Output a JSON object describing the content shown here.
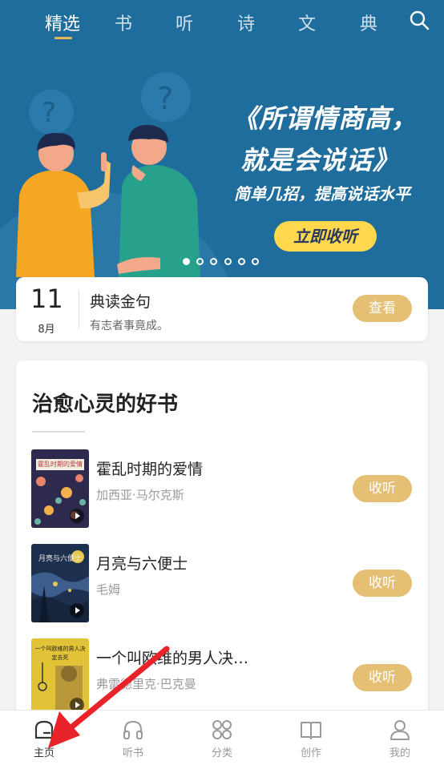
{
  "tabs": [
    {
      "label": "精选",
      "active": true
    },
    {
      "label": "书"
    },
    {
      "label": "听"
    },
    {
      "label": "诗"
    },
    {
      "label": "文"
    },
    {
      "label": "典"
    }
  ],
  "banner": {
    "title_line1": "《所谓情商高，",
    "title_line2": "就是会说话》",
    "subtitle": "简单几招，提高说话水平",
    "button": "立即收听",
    "dot_count": 6,
    "active_dot": 0
  },
  "daily": {
    "day": "11",
    "month": "8月",
    "title": "典读金句",
    "quote": "有志者事竟成。",
    "button": "查看"
  },
  "section": {
    "title": "治愈心灵的好书",
    "books": [
      {
        "title": "霍乱时期的爱情",
        "author": "加西亚·马尔克斯",
        "cover_text": "霍乱时期的爱情",
        "button": "收听"
      },
      {
        "title": "月亮与六便士",
        "author": "毛姆",
        "cover_text": "月亮与六便士",
        "button": "收听"
      },
      {
        "title": "一个叫欧维的男人决…",
        "author": "弗雷德里克·巴克曼",
        "cover_text": "一个叫欧维的男人决定去死",
        "button": "收听"
      }
    ]
  },
  "nav": [
    {
      "label": "主页",
      "icon": "home-icon",
      "active": true
    },
    {
      "label": "听书",
      "icon": "headphones-icon"
    },
    {
      "label": "分类",
      "icon": "grid-icon"
    },
    {
      "label": "创作",
      "icon": "book-icon"
    },
    {
      "label": "我的",
      "icon": "user-icon"
    }
  ],
  "colors": {
    "banner_bg": "#1f6d9c",
    "accent_gold": "#e5c074",
    "banner_button": "#ffd84d",
    "annotation_arrow": "#e8232a"
  }
}
